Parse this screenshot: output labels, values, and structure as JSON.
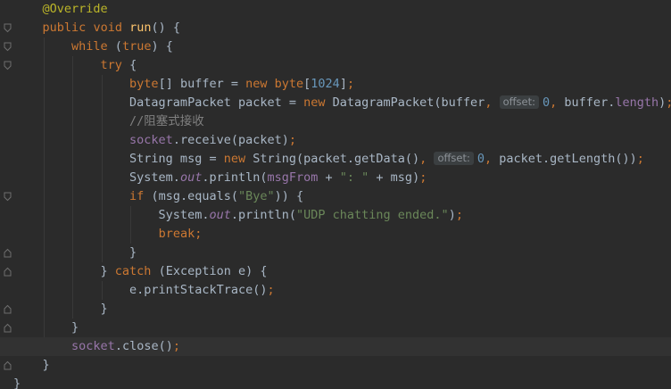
{
  "editor": {
    "lines": [
      {
        "fold": "none",
        "spans": [
          [
            "    ",
            ""
          ],
          [
            "@Override",
            "ann"
          ]
        ]
      },
      {
        "fold": "open",
        "spans": [
          [
            "    ",
            ""
          ],
          [
            "public",
            "kw"
          ],
          [
            " ",
            ""
          ],
          [
            "void",
            "kw"
          ],
          [
            " ",
            ""
          ],
          [
            "run",
            "fn"
          ],
          [
            "() {",
            ""
          ]
        ]
      },
      {
        "fold": "open",
        "spans": [
          [
            "        ",
            ""
          ],
          [
            "while",
            "kw"
          ],
          [
            " (",
            ""
          ],
          [
            "true",
            "kw"
          ],
          [
            ") {",
            ""
          ]
        ]
      },
      {
        "fold": "open",
        "spans": [
          [
            "            ",
            ""
          ],
          [
            "try",
            "kw"
          ],
          [
            " {",
            ""
          ]
        ]
      },
      {
        "fold": "none",
        "spans": [
          [
            "                ",
            ""
          ],
          [
            "byte",
            "kw"
          ],
          [
            "[] buffer = ",
            ""
          ],
          [
            "new",
            "kw"
          ],
          [
            " ",
            ""
          ],
          [
            "byte",
            "kw"
          ],
          [
            "[",
            ""
          ],
          [
            "1024",
            "num"
          ],
          [
            "]",
            ""
          ],
          [
            ";",
            "kw"
          ]
        ]
      },
      {
        "fold": "none",
        "spans": [
          [
            "                DatagramPacket packet = ",
            ""
          ],
          [
            "new",
            "kw"
          ],
          [
            " DatagramPacket(buffer",
            ""
          ],
          [
            ",",
            "kw"
          ],
          [
            " ",
            ""
          ],
          [
            "offset:",
            "hint"
          ],
          [
            "0",
            "num"
          ],
          [
            ",",
            "kw"
          ],
          [
            " buffer.",
            ""
          ],
          [
            "length",
            "fld"
          ],
          [
            ")",
            ""
          ],
          [
            ";",
            "kw"
          ]
        ]
      },
      {
        "fold": "none",
        "spans": [
          [
            "                ",
            ""
          ],
          [
            "//阻塞式接收",
            "cmt"
          ]
        ]
      },
      {
        "fold": "none",
        "spans": [
          [
            "                ",
            ""
          ],
          [
            "socket",
            "fld"
          ],
          [
            ".receive(packet)",
            ""
          ],
          [
            ";",
            "kw"
          ]
        ]
      },
      {
        "fold": "none",
        "spans": [
          [
            "                String msg = ",
            ""
          ],
          [
            "new",
            "kw"
          ],
          [
            " String(packet.getData()",
            ""
          ],
          [
            ",",
            "kw"
          ],
          [
            " ",
            ""
          ],
          [
            "offset:",
            "hint"
          ],
          [
            "0",
            "num"
          ],
          [
            ",",
            "kw"
          ],
          [
            " packet.getLength())",
            ""
          ],
          [
            ";",
            "kw"
          ]
        ]
      },
      {
        "fold": "none",
        "spans": [
          [
            "                System.",
            ""
          ],
          [
            "out",
            "sfld"
          ],
          [
            ".println(",
            ""
          ],
          [
            "msgFrom",
            "fld"
          ],
          [
            " + ",
            ""
          ],
          [
            "\": \"",
            "str"
          ],
          [
            " + msg)",
            ""
          ],
          [
            ";",
            "kw"
          ]
        ]
      },
      {
        "fold": "open",
        "spans": [
          [
            "                ",
            ""
          ],
          [
            "if",
            "kw"
          ],
          [
            " (msg.equals(",
            ""
          ],
          [
            "\"Bye\"",
            "str"
          ],
          [
            ")) {",
            ""
          ]
        ]
      },
      {
        "fold": "none",
        "spans": [
          [
            "                    System.",
            ""
          ],
          [
            "out",
            "sfld"
          ],
          [
            ".println(",
            ""
          ],
          [
            "\"UDP chatting ended.\"",
            "str"
          ],
          [
            ")",
            ""
          ],
          [
            ";",
            "kw"
          ]
        ]
      },
      {
        "fold": "none",
        "spans": [
          [
            "                    ",
            ""
          ],
          [
            "break",
            "kw"
          ],
          [
            ";",
            "kw"
          ]
        ]
      },
      {
        "fold": "close",
        "spans": [
          [
            "                }",
            ""
          ]
        ]
      },
      {
        "fold": "close",
        "spans": [
          [
            "            } ",
            ""
          ],
          [
            "catch",
            "kw"
          ],
          [
            " (Exception e) {",
            ""
          ]
        ]
      },
      {
        "fold": "none",
        "spans": [
          [
            "                e.printStackTrace()",
            ""
          ],
          [
            ";",
            "kw"
          ]
        ]
      },
      {
        "fold": "close",
        "spans": [
          [
            "            }",
            ""
          ]
        ]
      },
      {
        "fold": "close",
        "spans": [
          [
            "        }",
            ""
          ]
        ]
      },
      {
        "fold": "none",
        "current": true,
        "spans": [
          [
            "        ",
            ""
          ],
          [
            "socket",
            "fld"
          ],
          [
            ".close()",
            ""
          ],
          [
            ";",
            "kw"
          ]
        ]
      },
      {
        "fold": "close",
        "spans": [
          [
            "    }",
            ""
          ]
        ]
      },
      {
        "fold": "none",
        "spans": [
          [
            "}",
            ""
          ]
        ]
      }
    ]
  }
}
